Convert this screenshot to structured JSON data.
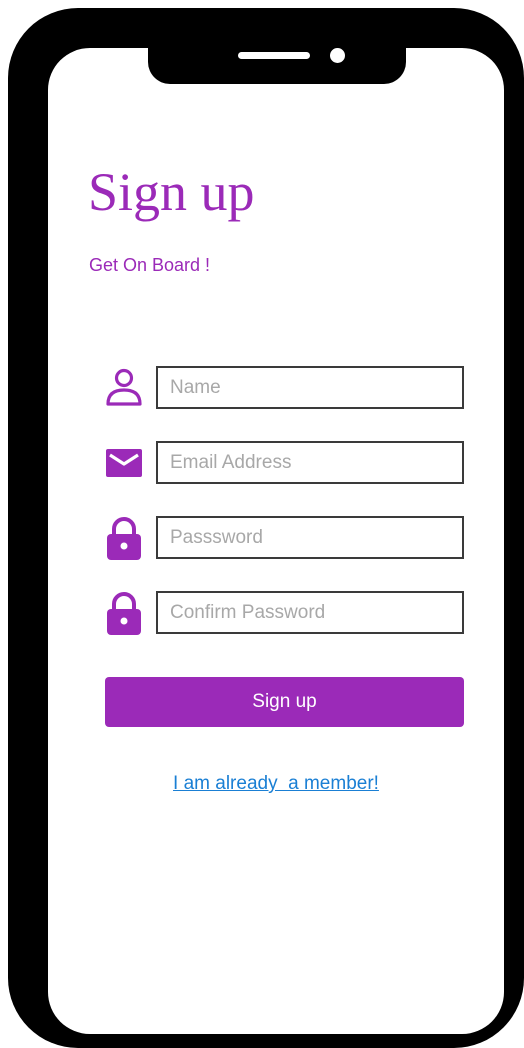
{
  "page": {
    "title": "Sign up",
    "subtitle": "Get On Board !"
  },
  "form": {
    "name": {
      "placeholder": "Name",
      "icon": "user-icon"
    },
    "email": {
      "placeholder": "Email Address",
      "icon": "envelope-icon"
    },
    "password": {
      "placeholder": "Passsword",
      "icon": "lock-icon"
    },
    "confirm_password": {
      "placeholder": "Confirm Password",
      "icon": "lock-icon"
    },
    "submit_label": "Sign up",
    "member_link": "I am already  a member!"
  },
  "colors": {
    "accent": "#9b2ab8",
    "link": "#1a7fd4",
    "frame": "#000000"
  }
}
